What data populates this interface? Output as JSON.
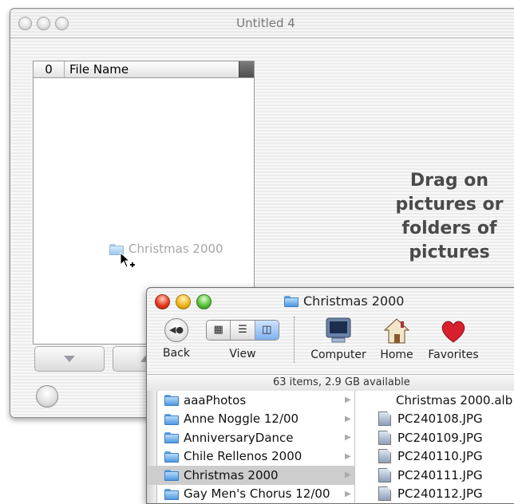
{
  "back_window": {
    "title": "Untitled 4",
    "list": {
      "count_col": "0",
      "name_col": "File Name"
    },
    "drag_item": "Christmas 2000",
    "drop_hint": [
      "Drag on",
      "pictures or",
      "folders of",
      "pictures"
    ]
  },
  "finder": {
    "title": "Christmas 2000",
    "toolbar": {
      "back": "Back",
      "view": "View",
      "computer": "Computer",
      "home": "Home",
      "favorites": "Favorites"
    },
    "status": "63 items, 2.9 GB available",
    "folders": [
      {
        "name": "aaaPhotos",
        "selected": false
      },
      {
        "name": "Anne Noggle 12/00",
        "selected": false
      },
      {
        "name": "AnniversaryDance",
        "selected": false
      },
      {
        "name": "Chile Rellenos 2000",
        "selected": false
      },
      {
        "name": "Christmas 2000",
        "selected": true
      },
      {
        "name": "Gay Men's Chorus 12/00",
        "selected": false
      }
    ],
    "files": [
      "Christmas 2000.alb",
      "PC240108.JPG",
      "PC240109.JPG",
      "PC240110.JPG",
      "PC240111.JPG",
      "PC240112.JPG"
    ]
  },
  "colors": {
    "accent_blue": "#4f98df",
    "heart_red": "#d8202d",
    "close_red": "#e63b1e"
  }
}
